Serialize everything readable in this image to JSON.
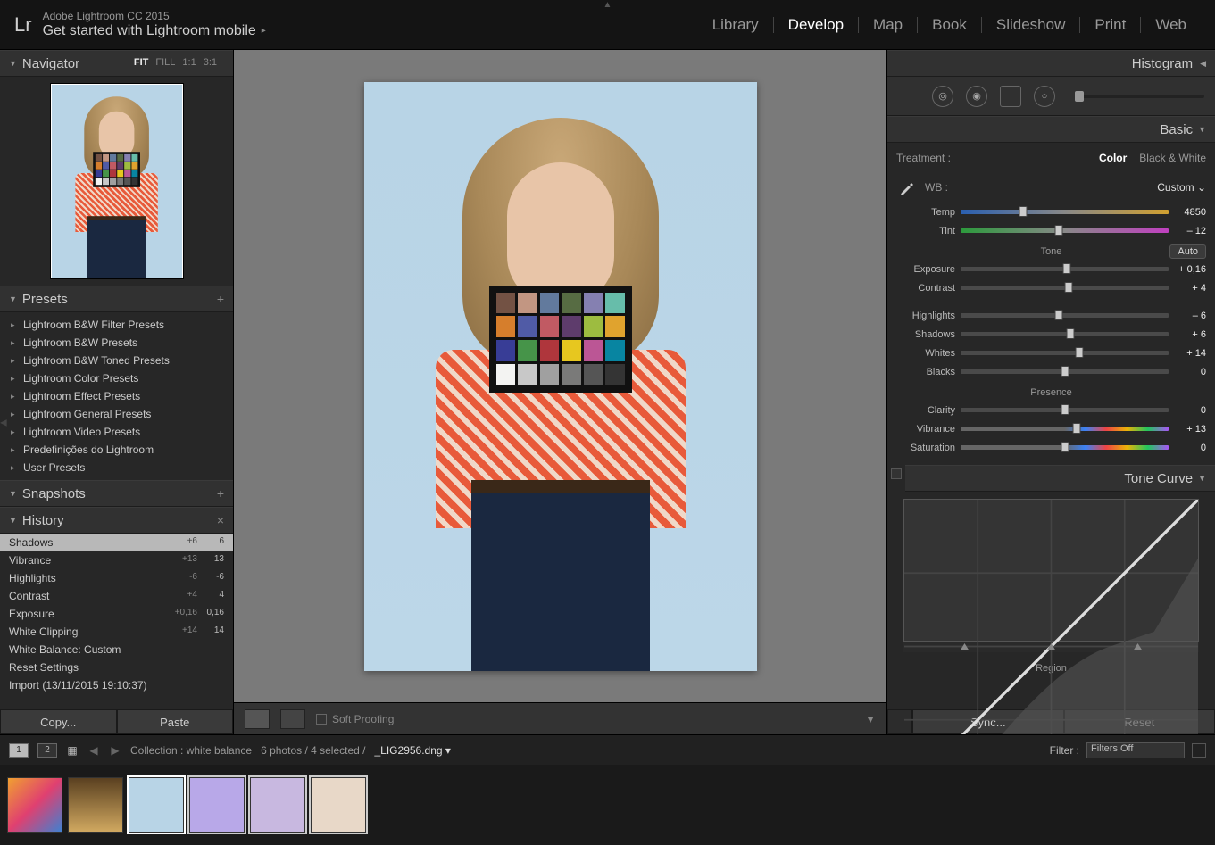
{
  "header": {
    "app_name": "Adobe Lightroom CC 2015",
    "subtitle": "Get started with Lightroom mobile",
    "logo": "Lr"
  },
  "modules": {
    "items": [
      "Library",
      "Develop",
      "Map",
      "Book",
      "Slideshow",
      "Print",
      "Web"
    ],
    "active": "Develop"
  },
  "navigator": {
    "title": "Navigator",
    "modes": [
      "FIT",
      "FILL",
      "1:1",
      "3:1"
    ],
    "active_mode": "FIT"
  },
  "presets": {
    "title": "Presets",
    "items": [
      "Lightroom B&W Filter Presets",
      "Lightroom B&W Presets",
      "Lightroom B&W Toned Presets",
      "Lightroom Color Presets",
      "Lightroom Effect Presets",
      "Lightroom General Presets",
      "Lightroom Video Presets",
      "Predefinições do Lightroom",
      "User Presets"
    ]
  },
  "snapshots": {
    "title": "Snapshots"
  },
  "history": {
    "title": "History",
    "items": [
      {
        "label": "Shadows",
        "delta": "+6",
        "value": "6"
      },
      {
        "label": "Vibrance",
        "delta": "+13",
        "value": "13"
      },
      {
        "label": "Highlights",
        "delta": "-6",
        "value": "-6"
      },
      {
        "label": "Contrast",
        "delta": "+4",
        "value": "4"
      },
      {
        "label": "Exposure",
        "delta": "+0,16",
        "value": "0,16"
      },
      {
        "label": "White Clipping",
        "delta": "+14",
        "value": "14"
      },
      {
        "label": "White Balance: Custom",
        "delta": "",
        "value": ""
      },
      {
        "label": "Reset Settings",
        "delta": "",
        "value": ""
      },
      {
        "label": "Import (13/11/2015 19:10:37)",
        "delta": "",
        "value": ""
      }
    ]
  },
  "copy_paste": {
    "copy": "Copy...",
    "paste": "Paste"
  },
  "canvas": {
    "soft_proofing": "Soft Proofing"
  },
  "right": {
    "histogram_title": "Histogram",
    "tool_names": [
      "crop-icon",
      "spot-icon",
      "redeye-icon",
      "gradient-icon",
      "radial-icon",
      "brush-icon"
    ]
  },
  "basic": {
    "title": "Basic",
    "treatment_label": "Treatment :",
    "treatment_options": {
      "color": "Color",
      "bw": "Black & White"
    },
    "wb_label": "WB :",
    "wb_value": "Custom",
    "temp_label": "Temp",
    "temp_value": "4850",
    "tint_label": "Tint",
    "tint_value": "– 12",
    "tone_label": "Tone",
    "auto_label": "Auto",
    "exposure_label": "Exposure",
    "exposure_value": "+ 0,16",
    "contrast_label": "Contrast",
    "contrast_value": "+ 4",
    "highlights_label": "Highlights",
    "highlights_value": "– 6",
    "shadows_label": "Shadows",
    "shadows_value": "+ 6",
    "whites_label": "Whites",
    "whites_value": "+ 14",
    "blacks_label": "Blacks",
    "blacks_value": "0",
    "presence_label": "Presence",
    "clarity_label": "Clarity",
    "clarity_value": "0",
    "vibrance_label": "Vibrance",
    "vibrance_value": "+ 13",
    "saturation_label": "Saturation",
    "saturation_value": "0"
  },
  "tone_curve": {
    "title": "Tone Curve",
    "region_label": "Region"
  },
  "sync_reset": {
    "sync": "Sync...",
    "reset": "Reset"
  },
  "filmstrip": {
    "collection_label": "Collection : white balance",
    "count_label": "6 photos / 4 selected /",
    "filename": "_LIG2956.dng",
    "filter_label": "Filter :",
    "filter_value": "Filters Off",
    "stack1": "1",
    "stack2": "2"
  },
  "checker_colors": [
    "#735244",
    "#c29682",
    "#627a9d",
    "#576c43",
    "#8580b1",
    "#67bdaa",
    "#d67e2c",
    "#505ba6",
    "#c15a63",
    "#5e3c6c",
    "#9dbc40",
    "#e0a32e",
    "#383d96",
    "#469449",
    "#af363c",
    "#e7c71f",
    "#bb5695",
    "#0885a1",
    "#f3f3f2",
    "#c8c8c8",
    "#a0a0a0",
    "#7a7a79",
    "#555555",
    "#343434"
  ]
}
